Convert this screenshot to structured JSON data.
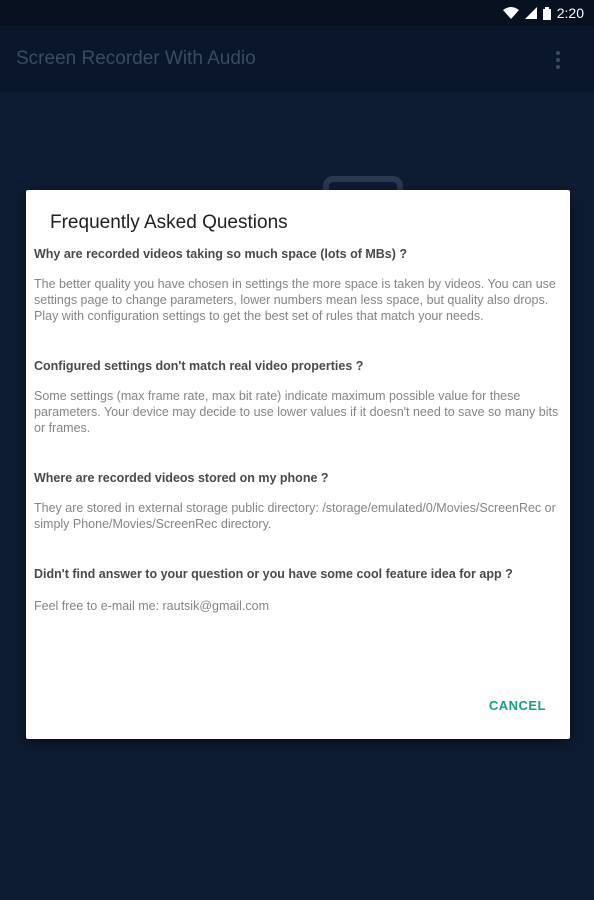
{
  "status_bar": {
    "time": "2:20",
    "icons": [
      "wifi-icon",
      "cell-signal-icon",
      "battery-icon"
    ]
  },
  "app_bar": {
    "title": "Screen Recorder With Audio",
    "menu_icon": "overflow-menu-icon"
  },
  "dialog": {
    "title": "Frequently Asked Questions",
    "faq": [
      {
        "question": "Why are recorded videos taking so much space (lots of MBs) ?",
        "answer": "The better quality you have chosen in settings the more space is taken by videos. You can use settings page to change parameters, lower numbers mean less space, but quality also drops. Play with configuration settings to get the best set of rules that match your needs."
      },
      {
        "question": "Configured settings don't match real video properties ?",
        "answer": "Some settings (max frame rate, max bit rate) indicate maximum possible value for these parameters. Your device may decide to use lower values if it doesn't need to save so many bits or frames."
      },
      {
        "question": "Where are recorded videos stored on my phone ?",
        "answer": "They are stored in external storage public directory: /storage/emulated/0/Movies/ScreenRec or simply Phone/Movies/ScreenRec directory."
      },
      {
        "question": "Didn't find answer to your question or you have some cool feature idea for app ?",
        "answer": "Feel free to e-mail me: rautsik@gmail.com"
      }
    ],
    "cancel_label": "CANCEL"
  },
  "colors": {
    "status_bar_bg": "#07111f",
    "app_bar_bg": "#0a1629",
    "content_bg": "#0e1c33",
    "dialog_bg": "#ffffff",
    "accent": "#1a9c8b"
  }
}
